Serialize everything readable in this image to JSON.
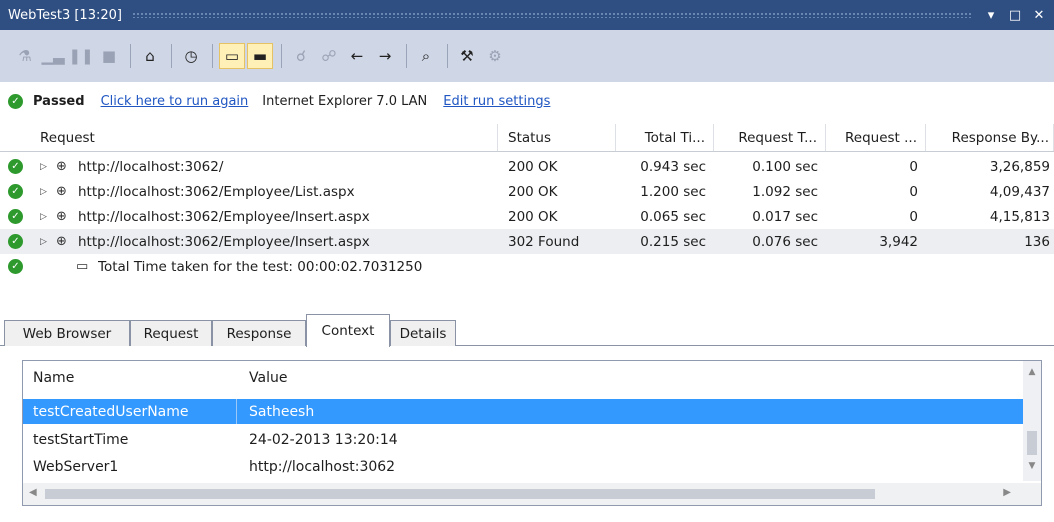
{
  "window": {
    "title": "WebTest3 [13:20]"
  },
  "titlebar": {
    "dropdown_icon": "▾",
    "maximize_icon": "□",
    "close_icon": "✕"
  },
  "status": {
    "result": "Passed",
    "run_again_link": "Click here to run again",
    "environment": "Internet Explorer 7.0  LAN",
    "edit_settings_link": "Edit run settings"
  },
  "grid": {
    "columns": [
      "Request",
      "Status",
      "Total Ti...",
      "Request T...",
      "Request ...",
      "Response By..."
    ],
    "rows": [
      {
        "url": "http://localhost:3062/",
        "status": "200 OK",
        "total": "0.943 sec",
        "request_time": "0.100 sec",
        "request_bytes": "0",
        "response_bytes": "3,26,859"
      },
      {
        "url": "http://localhost:3062/Employee/List.aspx",
        "status": "200 OK",
        "total": "1.200 sec",
        "request_time": "1.092 sec",
        "request_bytes": "0",
        "response_bytes": "4,09,437"
      },
      {
        "url": "http://localhost:3062/Employee/Insert.aspx",
        "status": "200 OK",
        "total": "0.065 sec",
        "request_time": "0.017 sec",
        "request_bytes": "0",
        "response_bytes": "4,15,813"
      },
      {
        "url": "http://localhost:3062/Employee/Insert.aspx",
        "status": "302 Found",
        "total": "0.215 sec",
        "request_time": "0.076 sec",
        "request_bytes": "3,942",
        "response_bytes": "136"
      }
    ],
    "summary": "Total Time taken for the test: 00:00:02.7031250"
  },
  "tabs": [
    "Web Browser",
    "Request",
    "Response",
    "Context",
    "Details"
  ],
  "context": {
    "columns": {
      "name": "Name",
      "value": "Value"
    },
    "rows": [
      {
        "name": "testCreatedUserName",
        "value": "Satheesh"
      },
      {
        "name": "testStartTime",
        "value": "24-02-2013 13:20:14"
      },
      {
        "name": "WebServer1",
        "value": "http://localhost:3062"
      }
    ]
  },
  "colors": {
    "titlebar": "#2f4f82",
    "toolbar": "#cfd6e5",
    "selection": "#3399ff",
    "link": "#1f56c2",
    "pass": "#2e9a2e"
  }
}
